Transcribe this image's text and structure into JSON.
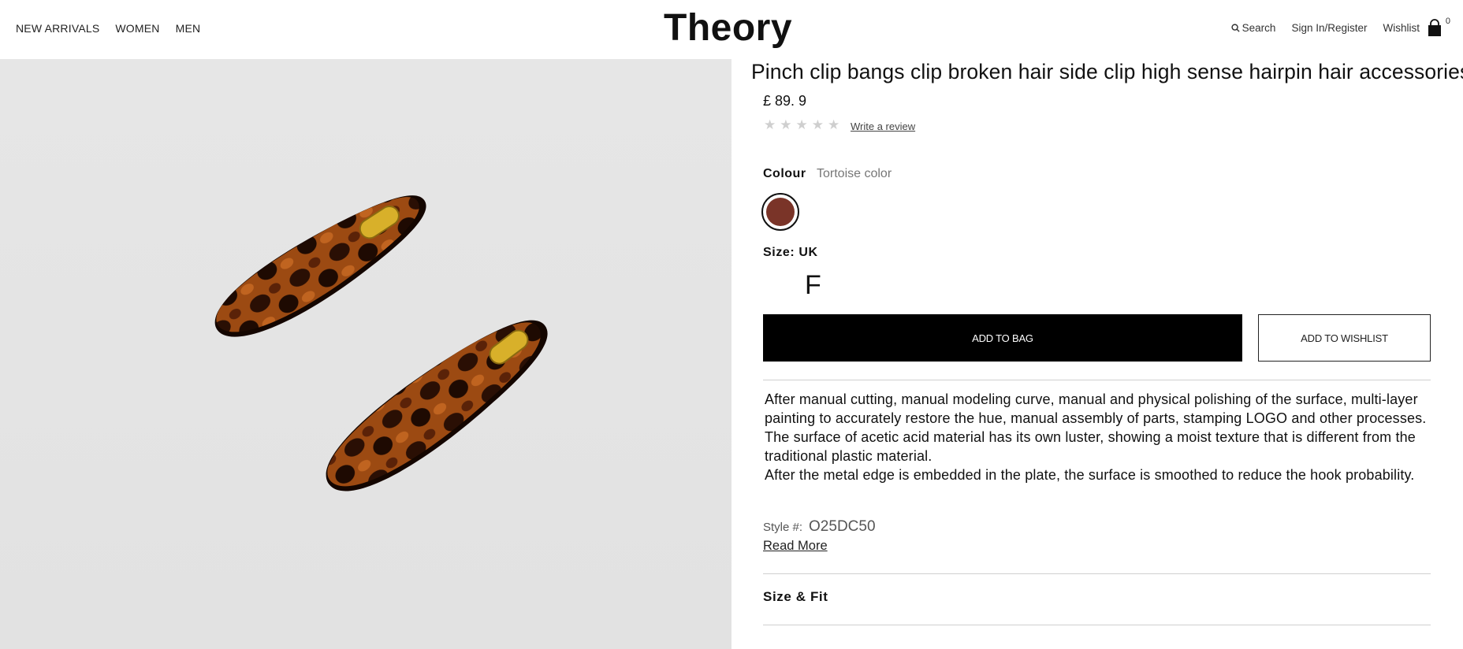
{
  "header": {
    "nav_left": [
      "NEW ARRIVALS",
      "WOMEN",
      "MEN"
    ],
    "logo": "Theory",
    "search_label": "Search",
    "signin_label": "Sign In/Register",
    "wishlist_label": "Wishlist",
    "bag_count": "0"
  },
  "product": {
    "title": "Pinch clip bangs clip broken hair side clip high sense hairpin hair accessories.",
    "price": "£ 89. 9",
    "rating_stars": 0,
    "review_link": "Write a review",
    "colour_label": "Colour",
    "colour_value": "Tortoise color",
    "swatch_color": "#7a3428",
    "size_label": "Size: UK",
    "size_option": "F",
    "add_to_bag": "ADD TO BAG",
    "add_to_wishlist": "ADD TO WISHLIST",
    "description": [
      "After manual cutting, manual modeling curve, manual and physical polishing of the surface, multi-layer painting to accurately restore the hue, manual assembly of parts, stamping LOGO and other processes. The surface of acetic acid material has its own luster, showing a moist texture that is different from the traditional plastic material.",
      "After the metal edge is embedded in the plate, the surface is smoothed to reduce the hook probability."
    ],
    "style_label": "Style #:",
    "style_value": "O25DC50",
    "read_more": "Read More",
    "size_fit": "Size & Fit"
  }
}
